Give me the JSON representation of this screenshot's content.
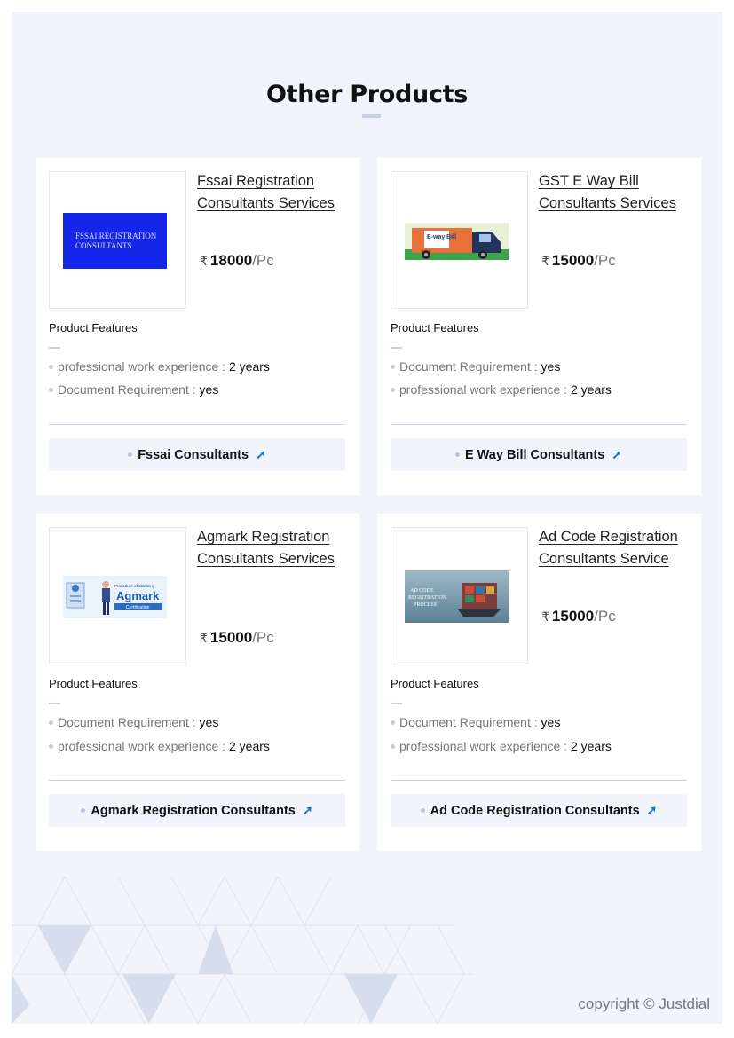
{
  "section": {
    "title": "Other Products",
    "features_label": "Product Features"
  },
  "products": [
    {
      "title": "Fssai Registration Consultants Services",
      "image_label": "FSSAI REGISTRATION CONSULTANTS",
      "currency": "₹",
      "price": "18000",
      "unit": "/Pc",
      "features": [
        {
          "label": "professional work experience : ",
          "value": "2 years"
        },
        {
          "label": "Document Requirement : ",
          "value": "yes"
        }
      ],
      "cta": "Fssai Consultants"
    },
    {
      "title": "GST E Way Bill Consultants Services",
      "image_label": "E-way Bill",
      "currency": "₹",
      "price": "15000",
      "unit": "/Pc",
      "features": [
        {
          "label": "Document Requirement : ",
          "value": "yes"
        },
        {
          "label": "professional work experience : ",
          "value": "2 years"
        }
      ],
      "cta": "E Way Bill Consultants"
    },
    {
      "title": "Agmark Registration Consultants Services",
      "image_label": "Agmark",
      "image_caption": "Procedure of obtaining",
      "image_sub": "Certification",
      "currency": "₹",
      "price": "15000",
      "unit": "/Pc",
      "features": [
        {
          "label": "Document Requirement : ",
          "value": "yes"
        },
        {
          "label": "professional work experience : ",
          "value": "2 years"
        }
      ],
      "cta": "Agmark Registration Consultants"
    },
    {
      "title": "Ad Code Registration Consultants Service",
      "image_label": "AD CODE REGISTRATION PROCESS",
      "currency": "₹",
      "price": "15000",
      "unit": "/Pc",
      "features": [
        {
          "label": "Document Requirement : ",
          "value": "yes"
        },
        {
          "label": "professional work experience : ",
          "value": "2 years"
        }
      ],
      "cta": "Ad Code Registration Consultants"
    }
  ],
  "cta_icon": "arrow-up-right-icon",
  "footer": {
    "copyright": "copyright © Justdial"
  },
  "colors": {
    "page_bg": "#f1f4fa",
    "card_bg": "#ffffff",
    "accent_bar": "#c5d0ea",
    "arrow": "#1a73c9",
    "fssai_blue": "#1526e8"
  }
}
